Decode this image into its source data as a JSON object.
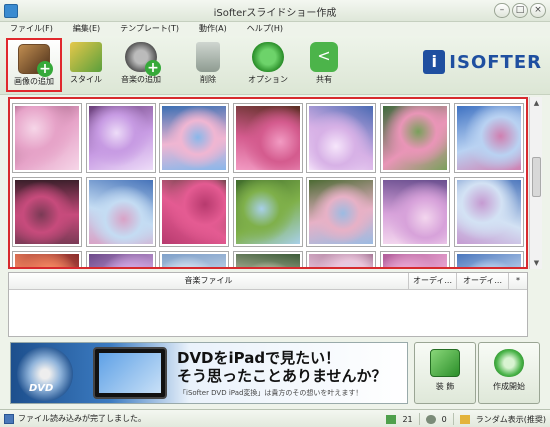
{
  "window": {
    "title": "iSofterスライドショー作成",
    "controls": [
      "–",
      "□",
      "×"
    ]
  },
  "menu": [
    "ファイル(F)",
    "編集(E)",
    "テンプレート(T)",
    "動作(A)",
    "ヘルプ(H)"
  ],
  "toolbar": [
    {
      "id": "add-image",
      "label": "画像の追加",
      "icon": "image-add-icon",
      "active": true
    },
    {
      "id": "style",
      "label": "スタイル",
      "icon": "style-stars-icon",
      "active": false
    },
    {
      "id": "add-music",
      "label": "音楽の追加",
      "icon": "music-add-icon",
      "active": false
    },
    {
      "id": "delete",
      "label": "削除",
      "icon": "trash-icon",
      "active": false
    },
    {
      "id": "option",
      "label": "オプション",
      "icon": "gear-icon",
      "active": false
    },
    {
      "id": "share",
      "label": "共有",
      "icon": "share-icon",
      "active": false
    }
  ],
  "brand": {
    "badge": "i",
    "text": "ISOFTER",
    "color": "#1f4fa0"
  },
  "gallery": {
    "rows": 3,
    "visible_thumbnails": 21,
    "subject": "cherry blossom photos",
    "scroll_up": "▲",
    "scroll_down": "▼"
  },
  "music_table": {
    "columns": [
      "音楽ファイル",
      "オーディ...",
      "オーディ...",
      "*"
    ]
  },
  "banner": {
    "disc_label": "DVD",
    "line1": "DVDをiPadで見たい！",
    "line2": "そう思ったことありませんか？",
    "subtitle": "「iSofter DVD iPad変換」は貴方のその想いを叶えます！"
  },
  "actions": [
    {
      "id": "decorate",
      "label": "装 飾",
      "icon": "decorate-icon"
    },
    {
      "id": "create",
      "label": "作成開始",
      "icon": "create-start-icon"
    }
  ],
  "status": {
    "message": "ファイル読み込みが完了しました。",
    "image_count": "21",
    "music_count": "0",
    "mode": "ランダム表示(推奨)"
  },
  "colors": {
    "accent": "#d72a2e",
    "toolbar_bg": "#dce6d5",
    "brand": "#1f4fa0"
  }
}
